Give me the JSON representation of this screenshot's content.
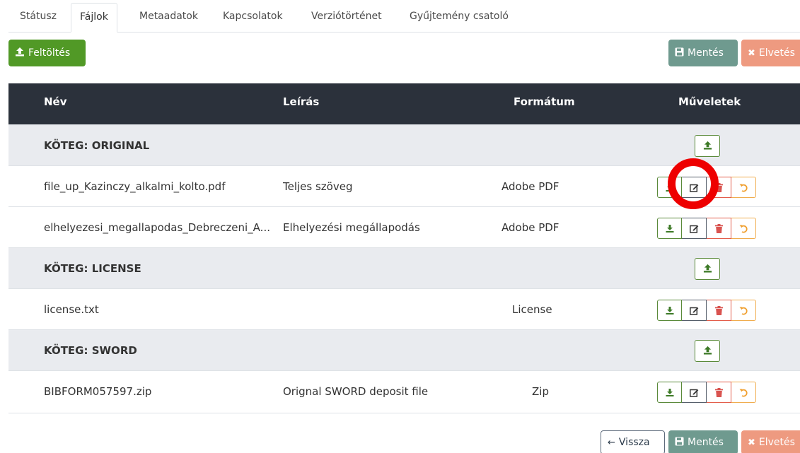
{
  "tabs": [
    {
      "label": "Státusz"
    },
    {
      "label": "Fájlok",
      "active": true
    },
    {
      "label": "Metaadatok"
    },
    {
      "label": "Kapcsolatok"
    },
    {
      "label": "Verziótörténet"
    },
    {
      "label": "Gyűjtemény csatoló"
    }
  ],
  "toolbar": {
    "upload_label": "Feltöltés",
    "save_label": "Mentés",
    "discard_label": "Elvetés"
  },
  "table": {
    "columns": {
      "name": "Név",
      "description": "Leírás",
      "format": "Formátum",
      "actions": "Műveletek"
    },
    "bundles": [
      {
        "title": "KÖTEG: ORIGINAL",
        "files": [
          {
            "name": "file_up_Kazinczy_alkalmi_kolto.pdf",
            "description": "Teljes szöveg",
            "format": "Adobe PDF"
          },
          {
            "name": "elhelyezesi_megallapodas_Debreczeni_A...",
            "description": "Elhelyezési megállapodás",
            "format": "Adobe PDF"
          }
        ]
      },
      {
        "title": "KÖTEG: LICENSE",
        "files": [
          {
            "name": "license.txt",
            "description": "",
            "format": "License"
          }
        ]
      },
      {
        "title": "KÖTEG: SWORD",
        "files": [
          {
            "name": "BIBFORM057597.zip",
            "description": "Orignal SWORD deposit file",
            "format": "Zip"
          }
        ]
      }
    ]
  },
  "footer": {
    "back_label": "Vissza",
    "save_label": "Mentés",
    "discard_label": "Elvetés"
  },
  "icons": {
    "upload": "upload-icon",
    "save": "floppy-icon",
    "discard": "x-icon",
    "download": "download-icon",
    "edit": "edit-icon",
    "delete": "trash-icon",
    "revert": "undo-icon",
    "back": "arrow-left-icon"
  },
  "colors": {
    "upload_green": "#519926",
    "save_teal": "#6f9a8f",
    "discard_salmon": "#ee9a80",
    "header_dark": "#2b313b",
    "bundle_gray": "#e9ebef",
    "annotation_red": "#ee0000"
  }
}
